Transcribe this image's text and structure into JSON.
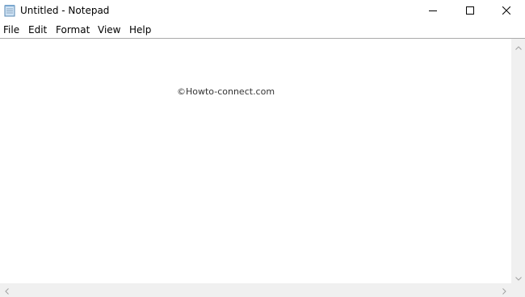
{
  "window": {
    "title": "Untitled - Notepad",
    "app_icon": "notepad-icon",
    "controls": {
      "minimize_icon": "minimize-icon",
      "maximize_icon": "maximize-icon",
      "close_icon": "close-icon"
    }
  },
  "menu": {
    "items": [
      {
        "label": "File"
      },
      {
        "label": "Edit"
      },
      {
        "label": "Format"
      },
      {
        "label": "View"
      },
      {
        "label": "Help"
      }
    ]
  },
  "editor": {
    "content": "©Howto-connect.com"
  },
  "colors": {
    "background": "#ffffff",
    "scrollbar_track": "#f0f0f0",
    "menu_divider": "#aaaaaa",
    "arrow": "#a0a0a0"
  }
}
